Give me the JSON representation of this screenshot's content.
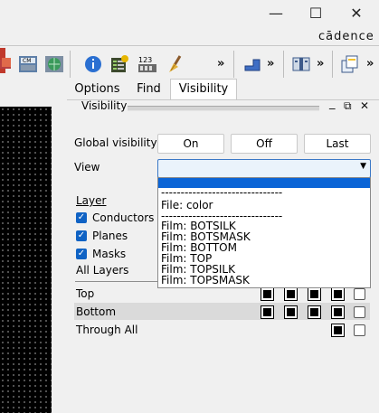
{
  "window": {
    "minimize_icon": "minimize-icon",
    "maximize_icon": "maximize-icon",
    "close_icon": "close-icon"
  },
  "brand": {
    "logo_text": "cādence"
  },
  "toolbar": {
    "more1": "»",
    "more2": "»",
    "more3": "»",
    "more4": "»",
    "icons": [
      "layers-icon",
      "cm-icon",
      "globe-icon",
      "info-icon",
      "checklist-icon",
      "123-icon",
      "broom-icon",
      "shape-icon",
      "panel-icon",
      "copy-icon"
    ]
  },
  "tabs": {
    "options": "Options",
    "find": "Find",
    "visibility": "Visibility"
  },
  "panel": {
    "title": "Visibility",
    "minimize": "_",
    "restore": "⧉",
    "close": "✕"
  },
  "global_visibility": {
    "label": "Global visibility",
    "on": "On",
    "off": "Off",
    "last": "Last"
  },
  "view": {
    "label": "View",
    "selected": "",
    "options": [
      "",
      "-------------------------------",
      "File: color",
      "-------------------------------",
      "Film: BOTSILK",
      "Film: BOTSMASK",
      "Film: BOTTOM",
      "Film: TOP",
      "Film: TOPSILK",
      "Film: TOPSMASK"
    ]
  },
  "layers": {
    "header": "Layer",
    "conductors": "Conductors",
    "planes": "Planes",
    "masks": "Masks",
    "all_layers": "All Layers",
    "rows": [
      {
        "name": "Top"
      },
      {
        "name": "Bottom"
      },
      {
        "name": "Through All"
      }
    ]
  },
  "colors": {
    "accent": "#0a64d6",
    "checkbox_blue": "#0f62c4",
    "highlight_row": "#dadada"
  }
}
